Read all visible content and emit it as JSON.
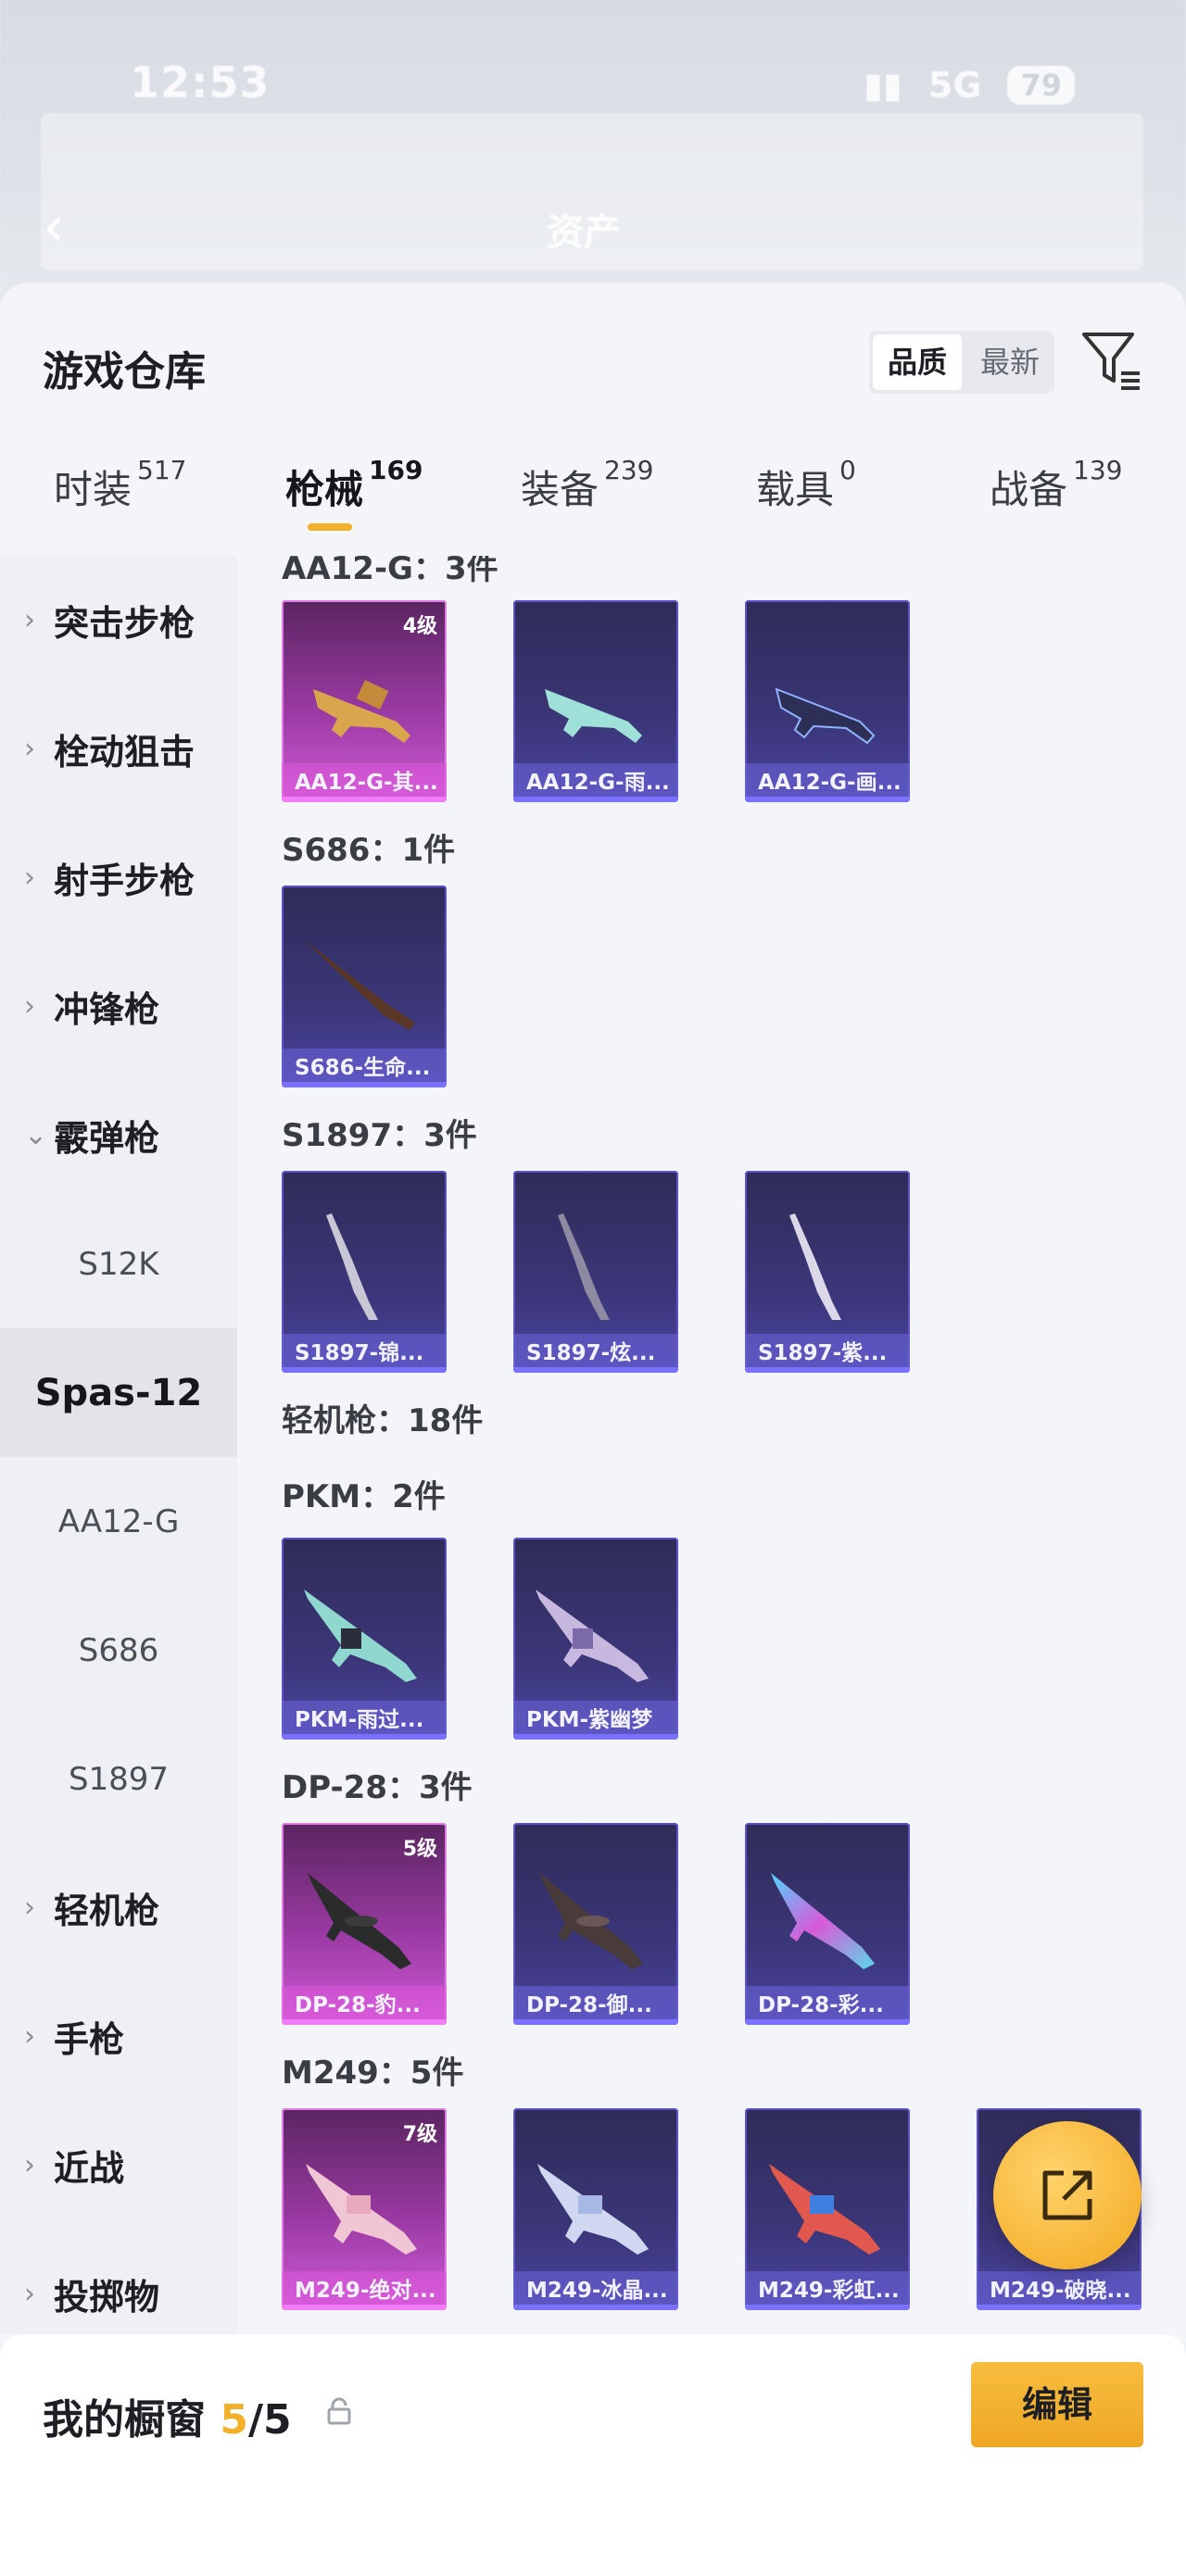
{
  "status_bar": {
    "time": "12:53",
    "network": "5G",
    "battery": "79"
  },
  "background": {
    "title": "资产"
  },
  "panel": {
    "title": "游戏仓库",
    "sort_options": [
      {
        "label": "品质",
        "active": true
      },
      {
        "label": "最新",
        "active": false
      }
    ]
  },
  "tabs": [
    {
      "label": "时装",
      "count": "517"
    },
    {
      "label": "枪械",
      "count": "169",
      "active": true
    },
    {
      "label": "装备",
      "count": "239"
    },
    {
      "label": "载具",
      "count": "0"
    },
    {
      "label": "战备",
      "count": "139"
    }
  ],
  "sidebar": {
    "categories": [
      {
        "label": "突击步枪"
      },
      {
        "label": "栓动狙击"
      },
      {
        "label": "射手步枪"
      },
      {
        "label": "冲锋枪"
      },
      {
        "label": "霰弹枪",
        "expanded": true
      }
    ],
    "sub_items": [
      {
        "label": "S12K"
      },
      {
        "label": "Spas-12",
        "active": true
      },
      {
        "label": "AA12-G"
      },
      {
        "label": "S686"
      },
      {
        "label": "S1897"
      }
    ],
    "more_categories": [
      {
        "label": "轻机枪"
      },
      {
        "label": "手枪"
      },
      {
        "label": "近战"
      },
      {
        "label": "投掷物"
      }
    ]
  },
  "content": {
    "partial_top_label": "AA12-G：3件",
    "group_s686": "S686：1件",
    "group_s1897": "S1897：3件",
    "section_lmg": "轻机枪：18件",
    "group_pkm": "PKM：2件",
    "group_dp28": "DP-28：3件",
    "group_m249": "M249：5件",
    "cards": {
      "aa12": [
        {
          "name": "AA12-G-其...",
          "level": "4级"
        },
        {
          "name": "AA12-G-雨..."
        },
        {
          "name": "AA12-G-画..."
        }
      ],
      "s686": [
        {
          "name": "S686-生命..."
        }
      ],
      "s1897": [
        {
          "name": "S1897-锦..."
        },
        {
          "name": "S1897-炫..."
        },
        {
          "name": "S1897-紫..."
        }
      ],
      "pkm": [
        {
          "name": "PKM-雨过..."
        },
        {
          "name": "PKM-紫幽梦"
        }
      ],
      "dp28": [
        {
          "name": "DP-28-豹...",
          "level": "5级"
        },
        {
          "name": "DP-28-御..."
        },
        {
          "name": "DP-28-彩..."
        }
      ],
      "m249": [
        {
          "name": "M249-绝对...",
          "level": "7级"
        },
        {
          "name": "M249-冰晶..."
        },
        {
          "name": "M249-彩虹..."
        },
        {
          "name": "M249-破晓..."
        }
      ]
    }
  },
  "bottom": {
    "showcase_label": "我的橱窗",
    "current": "5",
    "slash_total": "/5",
    "edit_label": "编辑"
  },
  "icons": {
    "filter": "filter-icon",
    "share": "share-icon",
    "lock": "lock-icon",
    "back": "back-icon"
  },
  "colors": {
    "accent": "#f3b12b",
    "card_blue": "#3b3678",
    "card_purple": "#9a3aa3"
  }
}
